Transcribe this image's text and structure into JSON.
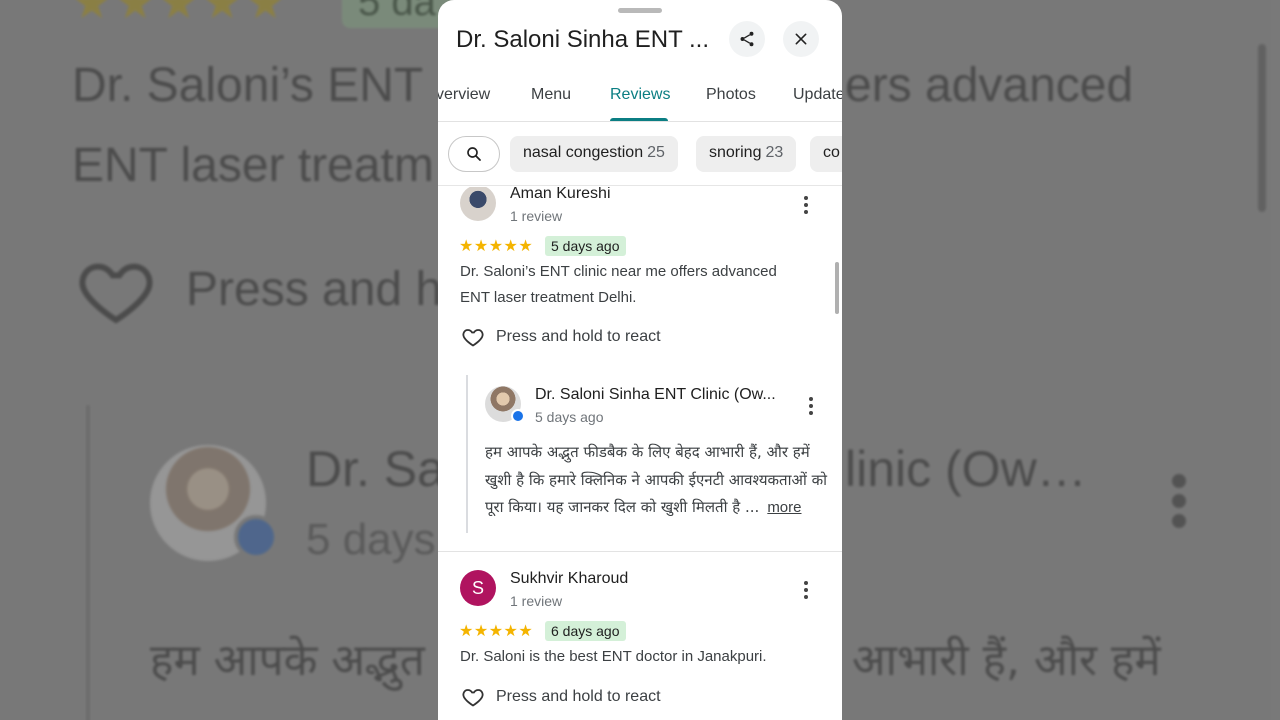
{
  "background": {
    "stars": "★★★★★",
    "badge": "5 da",
    "line1": "Dr. Saloni’s ENT",
    "line1_right": "ers advanced",
    "line2": "ENT laser treatm",
    "press": "Press and h",
    "doctor": "Dr. Sa",
    "clinic": "linic (Ow…",
    "days": "5 days",
    "hindi_left": "हम आपके अद्भुत",
    "hindi_right": "आभारी हैं, और हमें"
  },
  "header": {
    "title": "Dr. Saloni Sinha ENT ...",
    "share_icon": "share-icon",
    "close_icon": "close-icon"
  },
  "tabs": [
    {
      "label": "verview",
      "active": false
    },
    {
      "label": "Menu",
      "active": false
    },
    {
      "label": "Reviews",
      "active": true
    },
    {
      "label": "Photos",
      "active": false
    },
    {
      "label": "Update",
      "active": false
    }
  ],
  "chips": [
    {
      "label": "nasal congestion",
      "count": "25"
    },
    {
      "label": "snoring",
      "count": "23"
    },
    {
      "label": "co",
      "count": ""
    }
  ],
  "reviews": [
    {
      "name": "Aman Kureshi",
      "sub": "1 review",
      "stars": "★★★★★",
      "rating": 5,
      "date": "5 days ago",
      "text": "Dr. Saloni’s ENT clinic near me offers advanced ENT laser treatment Delhi.",
      "react": "Press and hold to react",
      "owner_reply": {
        "name": "Dr. Saloni Sinha ENT Clinic (Ow...",
        "date": "5 days ago",
        "text": "हम आपके अद्भुत फीडबैक के लिए बेहद आभारी हैं, और हमें खुशी है कि हमारे क्लिनिक ने आपकी ईएनटी आवश्यकताओं को पूरा किया। यह जानकर दिल को खुशी मिलती है ...",
        "more": "more"
      }
    },
    {
      "name": "Sukhvir Kharoud",
      "initial": "S",
      "avatar_color": "#b0135f",
      "sub": "1 review",
      "stars": "★★★★★",
      "rating": 5,
      "date": "6 days ago",
      "text": "Dr. Saloni is the best ENT doctor in Janakpuri.",
      "react": "Press and hold to react"
    }
  ],
  "colors": {
    "accent": "#0b7e83",
    "star": "#f4b400",
    "date_badge": "#d4f0d8"
  }
}
